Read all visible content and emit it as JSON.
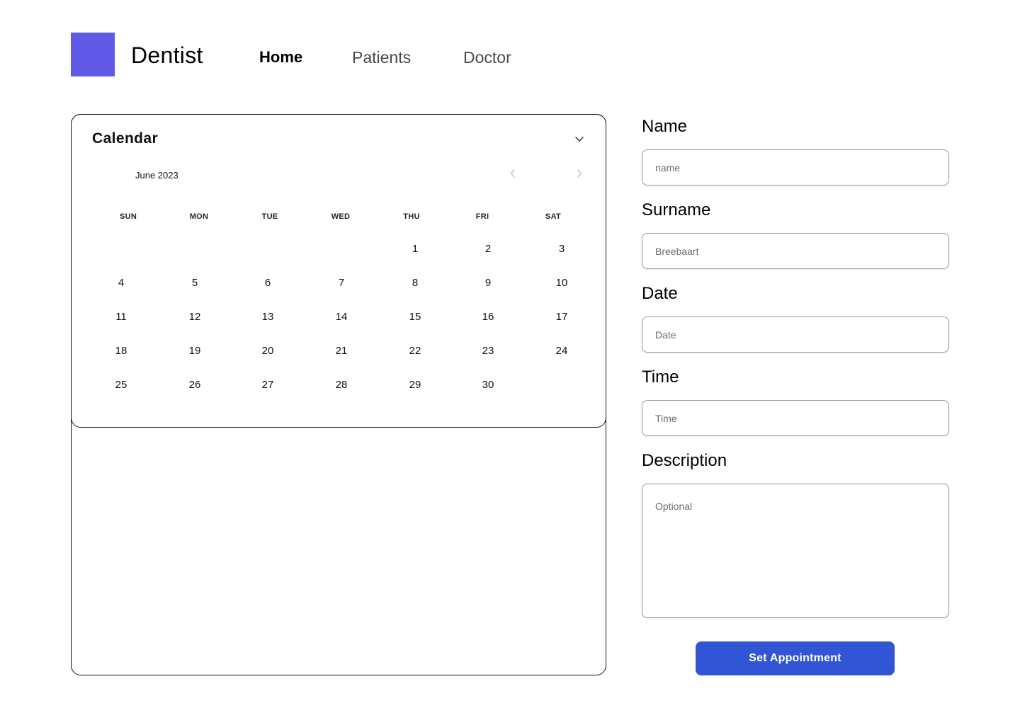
{
  "header": {
    "brand": "Dentist",
    "nav": [
      "Home",
      "Patients",
      "Doctor"
    ],
    "active_nav": "Home"
  },
  "calendar": {
    "title": "Calendar",
    "month": "June 2023",
    "weekdays": [
      "SUN",
      "MON",
      "TUE",
      "WED",
      "THU",
      "FRI",
      "SAT"
    ],
    "weeks": [
      [
        "",
        "",
        "",
        "",
        "1",
        "2",
        "3"
      ],
      [
        "4",
        "5",
        "6",
        "7",
        "8",
        "9",
        "10"
      ],
      [
        "11",
        "12",
        "13",
        "14",
        "15",
        "16",
        "17"
      ],
      [
        "18",
        "19",
        "20",
        "21",
        "22",
        "23",
        "24"
      ],
      [
        "25",
        "26",
        "27",
        "28",
        "29",
        "30",
        ""
      ]
    ]
  },
  "form": {
    "name_label": "Name",
    "name_placeholder": "name",
    "surname_label": "Surname",
    "surname_placeholder": "Breebaart",
    "date_label": "Date",
    "date_placeholder": "Date",
    "time_label": "Time",
    "time_placeholder": "Time",
    "description_label": "Description",
    "description_placeholder": "Optional",
    "submit_label": "Set Appointment"
  },
  "colors": {
    "logo": "#6059E6",
    "primary_button": "#3255D6"
  }
}
